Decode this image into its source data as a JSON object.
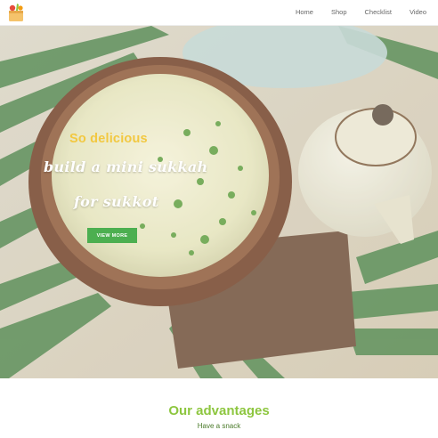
{
  "header": {
    "logo_icon": "grocery-basket-icon",
    "nav": [
      "Home",
      "Shop",
      "Checklist",
      "Video"
    ]
  },
  "hero": {
    "kicker": "So delicious",
    "title_line1": "build a mini sukkah",
    "title_line2": "for sukkot",
    "cta_label": "VIEW MORE",
    "cta_color": "#4caf50",
    "kicker_color": "#f2c840"
  },
  "advantages": {
    "title": "Our advantages",
    "subtitle": "Have a snack",
    "title_color": "#8dc63f"
  }
}
